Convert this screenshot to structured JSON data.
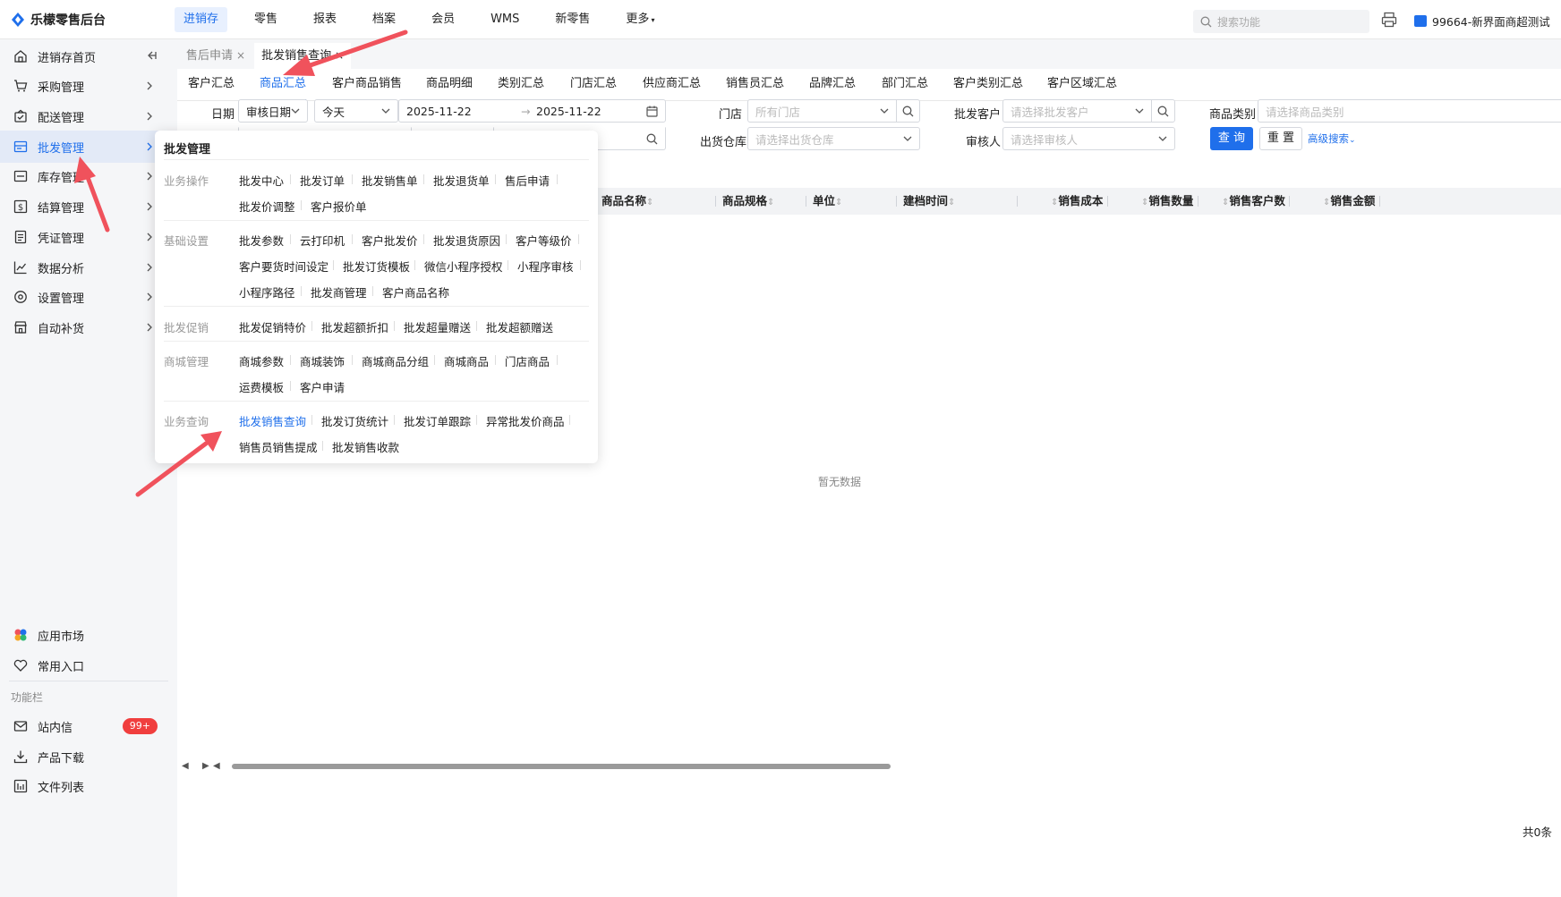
{
  "app": {
    "title": "乐檬零售后台"
  },
  "topnav": [
    "进销存",
    "零售",
    "报表",
    "档案",
    "会员",
    "WMS",
    "新零售",
    "更多"
  ],
  "topnav_active": "进销存",
  "header": {
    "search_placeholder": "搜索功能",
    "store_name": "99664-新界面商超测试"
  },
  "sidebar": {
    "items": [
      "进销存首页",
      "采购管理",
      "配送管理",
      "批发管理",
      "库存管理",
      "结算管理",
      "凭证管理",
      "数据分析",
      "设置管理",
      "自动补货"
    ],
    "active": "批发管理",
    "bottom_items": [
      "应用市场",
      "常用入口"
    ],
    "section_label": "功能栏",
    "func_items": [
      "站内信",
      "产品下载",
      "文件列表"
    ],
    "message_badge": "99+"
  },
  "page_tabs": [
    {
      "label": "售后申请",
      "close": "×"
    },
    {
      "label": "批发销售查询",
      "close": "×"
    }
  ],
  "sub_tabs": [
    "客户汇总",
    "商品汇总",
    "客户商品销售",
    "商品明细",
    "类别汇总",
    "门店汇总",
    "供应商汇总",
    "销售员汇总",
    "品牌汇总",
    "部门汇总",
    "客户类别汇总",
    "客户区域汇总"
  ],
  "sub_tab_active": "商品汇总",
  "filters": {
    "date_label": "日期",
    "date_type": "审核日期",
    "date_preset": "今天",
    "date_from": "2025-11-22",
    "date_sep": "→",
    "date_to": "2025-11-22",
    "store_label": "门店",
    "store_placeholder": "所有门店",
    "customer_label": "批发客户",
    "customer_placeholder": "请选择批发客户",
    "category_label": "商品类别",
    "category_placeholder": "请选择商品类别",
    "warehouse_label": "出货仓库",
    "warehouse_placeholder": "请选择出货仓库",
    "auditor_label": "审核人",
    "auditor_placeholder": "请选择审核人",
    "query_button": "查 询",
    "reset_button": "重 置",
    "advanced_link": "高级搜索"
  },
  "table": {
    "columns": [
      "商品名称",
      "商品规格",
      "单位",
      "建档时间",
      "销售成本",
      "销售数量",
      "销售客户数",
      "销售金额"
    ],
    "empty_text": "暂无数据",
    "total_text": "共0条"
  },
  "menu": {
    "title": "批发管理",
    "groups": [
      {
        "name": "业务操作",
        "items": [
          "批发中心",
          "批发订单",
          "批发销售单",
          "批发退货单",
          "售后申请",
          "批发价调整",
          "客户报价单"
        ]
      },
      {
        "name": "基础设置",
        "items": [
          "批发参数",
          "云打印机",
          "客户批发价",
          "批发退货原因",
          "客户等级价",
          "客户要货时间设定",
          "批发订货模板",
          "微信小程序授权",
          "小程序审核",
          "小程序路径",
          "批发商管理",
          "客户商品名称"
        ]
      },
      {
        "name": "批发促销",
        "items": [
          "批发促销特价",
          "批发超额折扣",
          "批发超量赠送",
          "批发超额赠送"
        ]
      },
      {
        "name": "商城管理",
        "items": [
          "商城参数",
          "商城装饰",
          "商城商品分组",
          "商城商品",
          "门店商品",
          "运费模板",
          "客户申请"
        ]
      },
      {
        "name": "业务查询",
        "items": [
          "批发销售查询",
          "批发订货统计",
          "批发订单跟踪",
          "异常批发价商品",
          "销售员销售提成",
          "批发销售收款"
        ]
      }
    ],
    "highlighted_item": "批发销售查询"
  },
  "colors": {
    "accent": "#1f6feb",
    "annotation_arrow": "#f0525c",
    "badge": "#f03e3e"
  }
}
